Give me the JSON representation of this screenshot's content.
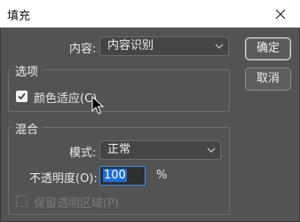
{
  "window": {
    "title": "填充"
  },
  "content": {
    "label": "内容:",
    "value": "内容识别"
  },
  "options_group": {
    "title": "选项",
    "color_adapt": {
      "label": "颜色适应(C)",
      "checked": true
    }
  },
  "blend_group": {
    "title": "混合",
    "mode": {
      "label": "模式:",
      "value": "正常"
    },
    "opacity": {
      "label": "不透明度(O):",
      "value": "100",
      "unit": "%"
    },
    "preserve_transparency": {
      "label": "保留透明区域(P)",
      "checked": false,
      "disabled": true
    }
  },
  "buttons": {
    "ok": "确定",
    "cancel": "取消"
  },
  "colors": {
    "dialog_bg": "#535353",
    "title_bg": "#ffffff",
    "focus": "#3d8ee6"
  }
}
